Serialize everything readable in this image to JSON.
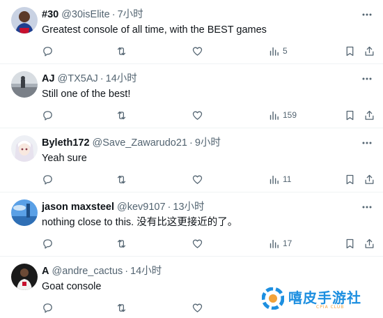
{
  "replies": [
    {
      "name": "#30",
      "handle": "@30isElite",
      "time": "7小时",
      "text": "Greatest console of all time, with the BEST games",
      "views": "5",
      "avatar": "basketball-player-avatar"
    },
    {
      "name": "AJ",
      "handle": "@TX5AJ",
      "time": "14小时",
      "text": "Still one of the best!",
      "views": "159",
      "avatar": "landscape-avatar"
    },
    {
      "name": "Byleth172",
      "handle": "@Save_Zawarudo21",
      "time": "9小时",
      "text": "Yeah sure",
      "views": "11",
      "avatar": "anime-girl-avatar"
    },
    {
      "name": "jason maxsteel",
      "handle": "@kev9107",
      "time": "13小时",
      "text": "nothing close to this. 没有比这更接近的了。",
      "views": "17",
      "avatar": "blue-sky-avatar"
    },
    {
      "name": "A",
      "handle": "@andre_cactus",
      "time": "14小时",
      "text": "Goat console",
      "views": "",
      "avatar": "player-avatar"
    }
  ],
  "separator": "·",
  "watermark": {
    "title": "嘻皮手游社",
    "subtitle": "CPIA CLUB"
  },
  "colors": {
    "text": "#0f1419",
    "muted": "#536471",
    "divider": "#eff3f4",
    "watermark_blue": "#1d8fe0",
    "watermark_orange": "#f2a23a"
  }
}
